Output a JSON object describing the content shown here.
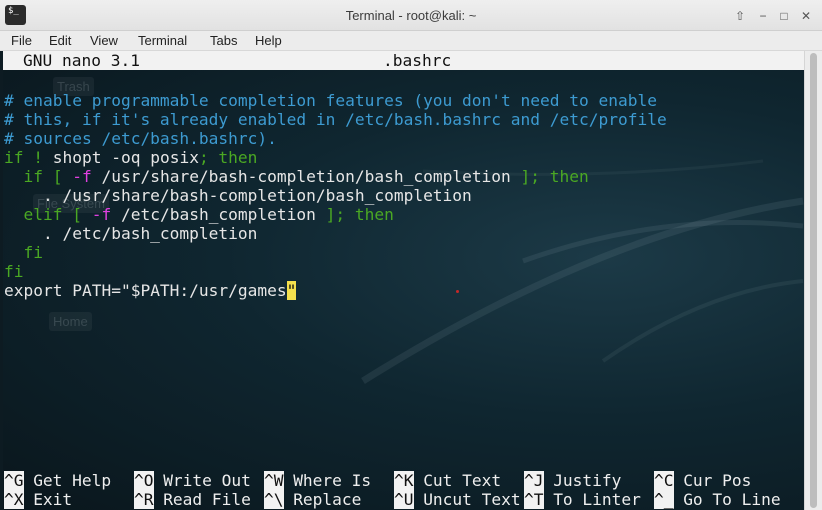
{
  "window": {
    "title": "Terminal - root@kali: ~",
    "buttons": [
      "⇧",
      "−",
      "□",
      "✕"
    ],
    "icon_glyph": "$_"
  },
  "menu": [
    "File",
    "Edit",
    "View",
    "Terminal",
    "Tabs",
    "Help"
  ],
  "desktop_icons": [
    "Trash",
    "File System",
    "Home"
  ],
  "nano": {
    "version": "GNU nano 3.1",
    "filename": ".bashrc"
  },
  "code": {
    "l1": "# enable programmable completion features (you don't need to enable",
    "l2": "# this, if it's already enabled in /etc/bash.bashrc and /etc/profile",
    "l3": "# sources /etc/bash.bashrc).",
    "l4": {
      "a": "if",
      "b": " ! ",
      "c": "shopt -oq posix",
      "d": "; then"
    },
    "l5": {
      "a": "  if",
      "b": " [ ",
      "c": "-f",
      "d": " /usr/share/bash-completion/bash_completion",
      "e": " ]; then"
    },
    "l6": "    . /usr/share/bash-completion/bash_completion",
    "l7": {
      "a": "  elif",
      "b": " [ ",
      "c": "-f",
      "d": " /etc/bash_completion",
      "e": " ]; then"
    },
    "l8": "    . /etc/bash_completion",
    "l9": "  fi",
    "l10": "fi",
    "l11": {
      "a": "export PATH=",
      "b": "\"$PATH:/usr/games",
      "c": "\""
    }
  },
  "shortcuts": [
    {
      "key": "^G",
      "label": "Get Help"
    },
    {
      "key": "^O",
      "label": "Write Out"
    },
    {
      "key": "^W",
      "label": "Where Is"
    },
    {
      "key": "^K",
      "label": "Cut Text"
    },
    {
      "key": "^J",
      "label": "Justify"
    },
    {
      "key": "^C",
      "label": "Cur Pos"
    },
    {
      "key": "^X",
      "label": "Exit"
    },
    {
      "key": "^R",
      "label": "Read File"
    },
    {
      "key": "^\\",
      "label": "Replace"
    },
    {
      "key": "^U",
      "label": "Uncut Text"
    },
    {
      "key": "^T",
      "label": "To Linter"
    },
    {
      "key": "^_",
      "label": "Go To Line"
    }
  ],
  "colors": {
    "comment": "#3d9bd1",
    "keyword": "#4aa823",
    "flag": "#e040e0",
    "string_highlight": "#f4e04d"
  }
}
